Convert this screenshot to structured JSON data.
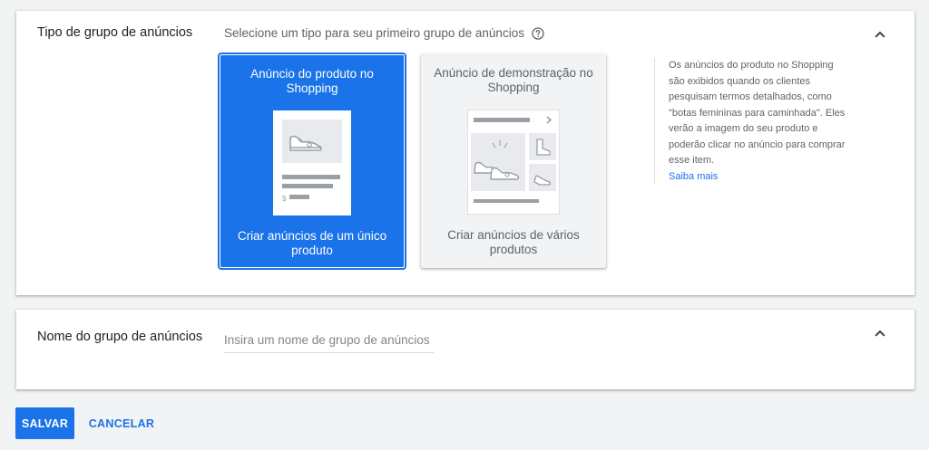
{
  "ad_group_type": {
    "title": "Tipo de grupo de anúncios",
    "subtitle": "Selecione um tipo para seu primeiro grupo de anúncios",
    "help_icon": "help-circle-icon",
    "collapse_icon": "chevron-up-icon",
    "options": [
      {
        "title": "Anúncio do produto no Shopping",
        "description": "Criar anúncios de um único produto",
        "selected": true
      },
      {
        "title": "Anúncio de demonstração no Shopping",
        "description": "Criar anúncios de vários produtos",
        "selected": false
      }
    ],
    "info_text": "Os anúncios do produto no Shopping são exibidos quando os clientes pesquisam termos detalhados, como \"botas femininas para caminhada\". Eles verão a imagem do seu produto e poderão clicar no anúncio para comprar esse item.",
    "learn_more": "Saiba mais"
  },
  "ad_group_name": {
    "title": "Nome do grupo de anúncios",
    "placeholder": "Insira um nome de grupo de anúncios",
    "value": "",
    "collapse_icon": "chevron-up-icon"
  },
  "actions": {
    "save_label": "SALVAR",
    "cancel_label": "CANCELAR"
  },
  "colors": {
    "accent": "#1a73e8",
    "background": "#f1f3f4",
    "card": "#ffffff"
  }
}
